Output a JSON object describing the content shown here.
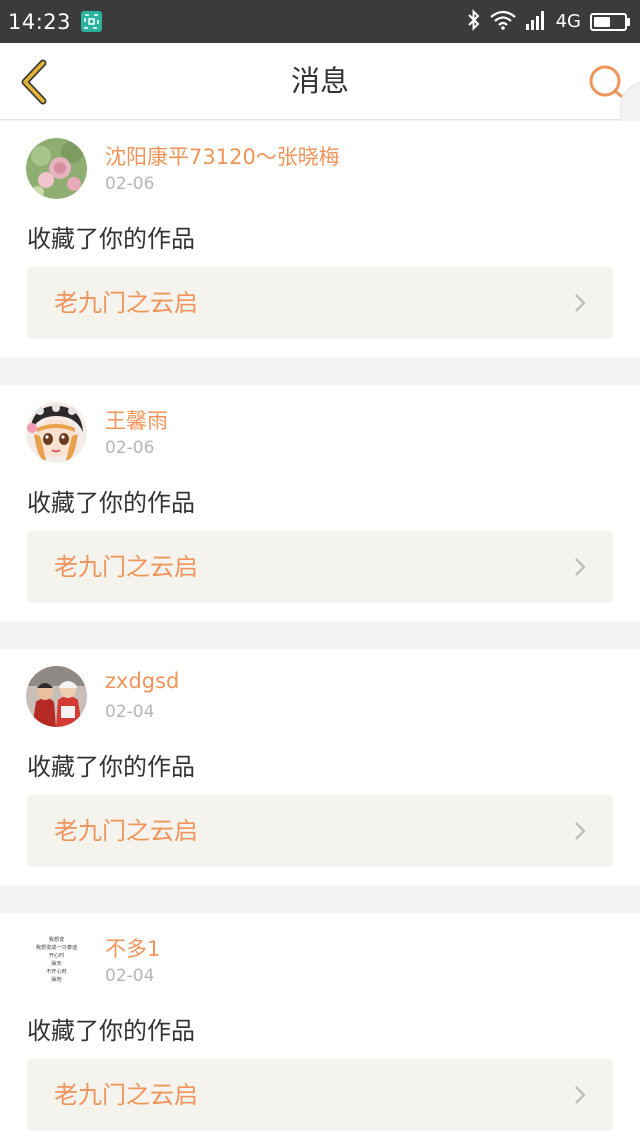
{
  "status_bar": {
    "time": "14:23",
    "network": "4G",
    "battery_level": 0.55,
    "icons": [
      "screenshot-icon",
      "bluetooth-icon",
      "wifi-icon",
      "signal-icon",
      "battery-icon"
    ]
  },
  "header": {
    "title": "消息",
    "back_icon": "chevron-left-icon",
    "search_icon": "search-icon"
  },
  "colors": {
    "accent": "#f0955a",
    "back_arrow": "#e5b434",
    "link_background": "#f4f3ee",
    "text": "#333333",
    "muted": "#b5b5b5"
  },
  "messages": [
    {
      "username": "沈阳康平73120～张晓梅",
      "date": "02-06",
      "action": "收藏了你的作品",
      "work_title": "老九门之云启",
      "avatar": "flowers"
    },
    {
      "username": "王馨雨",
      "date": "02-06",
      "action": "收藏了你的作品",
      "work_title": "老九门之云启",
      "avatar": "cartoon-girl"
    },
    {
      "username": "zxdgsd",
      "date": "02-04",
      "action": "收藏了你的作品",
      "work_title": "老九门之云启",
      "avatar": "couple-photo"
    },
    {
      "username": "不多1",
      "date": "02-04",
      "action": "收藏了你的作品",
      "work_title": "老九门之云启",
      "avatar": "text-image"
    }
  ],
  "avatar_text_lines": [
    "我想变",
    "我想变成一只泰迪",
    "开心时",
    "操天",
    "不开心时",
    "操地"
  ]
}
